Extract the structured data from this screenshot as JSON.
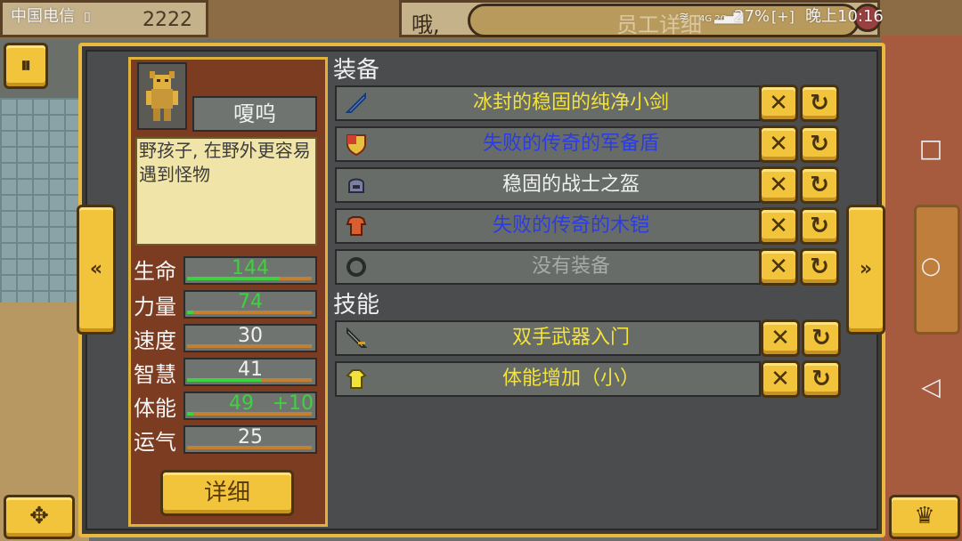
{
  "status_bar": {
    "carrier": "中国电信",
    "battery_percent": "27%",
    "time": "晚上10:16",
    "network": "4G 2G"
  },
  "background": {
    "coins": "2222",
    "dialog_text": "哦,"
  },
  "window": {
    "title": "员工详细"
  },
  "character": {
    "name": "嗄呜",
    "description": "野孩子, 在野外更容易遇到怪物",
    "stats": [
      {
        "label": "生命",
        "value": "144",
        "bonus": "",
        "value_color": "#3ed23e",
        "bar_fraction": 0.75
      },
      {
        "label": "力量",
        "value": "74",
        "bonus": "",
        "value_color": "#3ed23e",
        "bar_fraction": 0.05
      },
      {
        "label": "速度",
        "value": "30",
        "bonus": "",
        "value_color": "#f0f0f0",
        "bar_fraction": 0.0
      },
      {
        "label": "智慧",
        "value": "41",
        "bonus": "",
        "value_color": "#f0f0f0",
        "bar_fraction": 0.6
      },
      {
        "label": "体能",
        "value": "49",
        "bonus": "+10",
        "value_color": "#3ed23e",
        "bar_fraction": 0.05
      },
      {
        "label": "运气",
        "value": "25",
        "bonus": "",
        "value_color": "#f0f0f0",
        "bar_fraction": 0.0
      }
    ],
    "detail_button": "详细"
  },
  "equipment": {
    "title": "装备",
    "items": [
      {
        "label": "冰封的稳固的纯净小剑",
        "color": "#f2e23a",
        "icon": "sword-icon"
      },
      {
        "label": "失败的传奇的军备盾",
        "color": "#2b3ce0",
        "icon": "shield-icon"
      },
      {
        "label": "稳固的战士之盔",
        "color": "#f0f0f0",
        "icon": "helmet-icon"
      },
      {
        "label": "失败的传奇的木铠",
        "color": "#2b3ce0",
        "icon": "armor-icon"
      },
      {
        "label": "没有装备",
        "color": "#a8aaa8",
        "icon": "ring-icon"
      }
    ]
  },
  "skills": {
    "title": "技能",
    "items": [
      {
        "label": "双手武器入门",
        "color": "#f2e23a",
        "icon": "twohand-sword-icon"
      },
      {
        "label": "体能增加（小）",
        "color": "#f2e23a",
        "icon": "stamina-icon"
      }
    ]
  },
  "icons": {
    "remove": "✕",
    "swap": "↻",
    "left_arrow": "«",
    "right_arrow": "»",
    "pause": "⏸",
    "dpad": "✥",
    "crown": "♛"
  },
  "colors": {
    "accent": "#f2c43c",
    "dialog_border": "#e8b93c",
    "panel_brown": "#7c3c22"
  }
}
